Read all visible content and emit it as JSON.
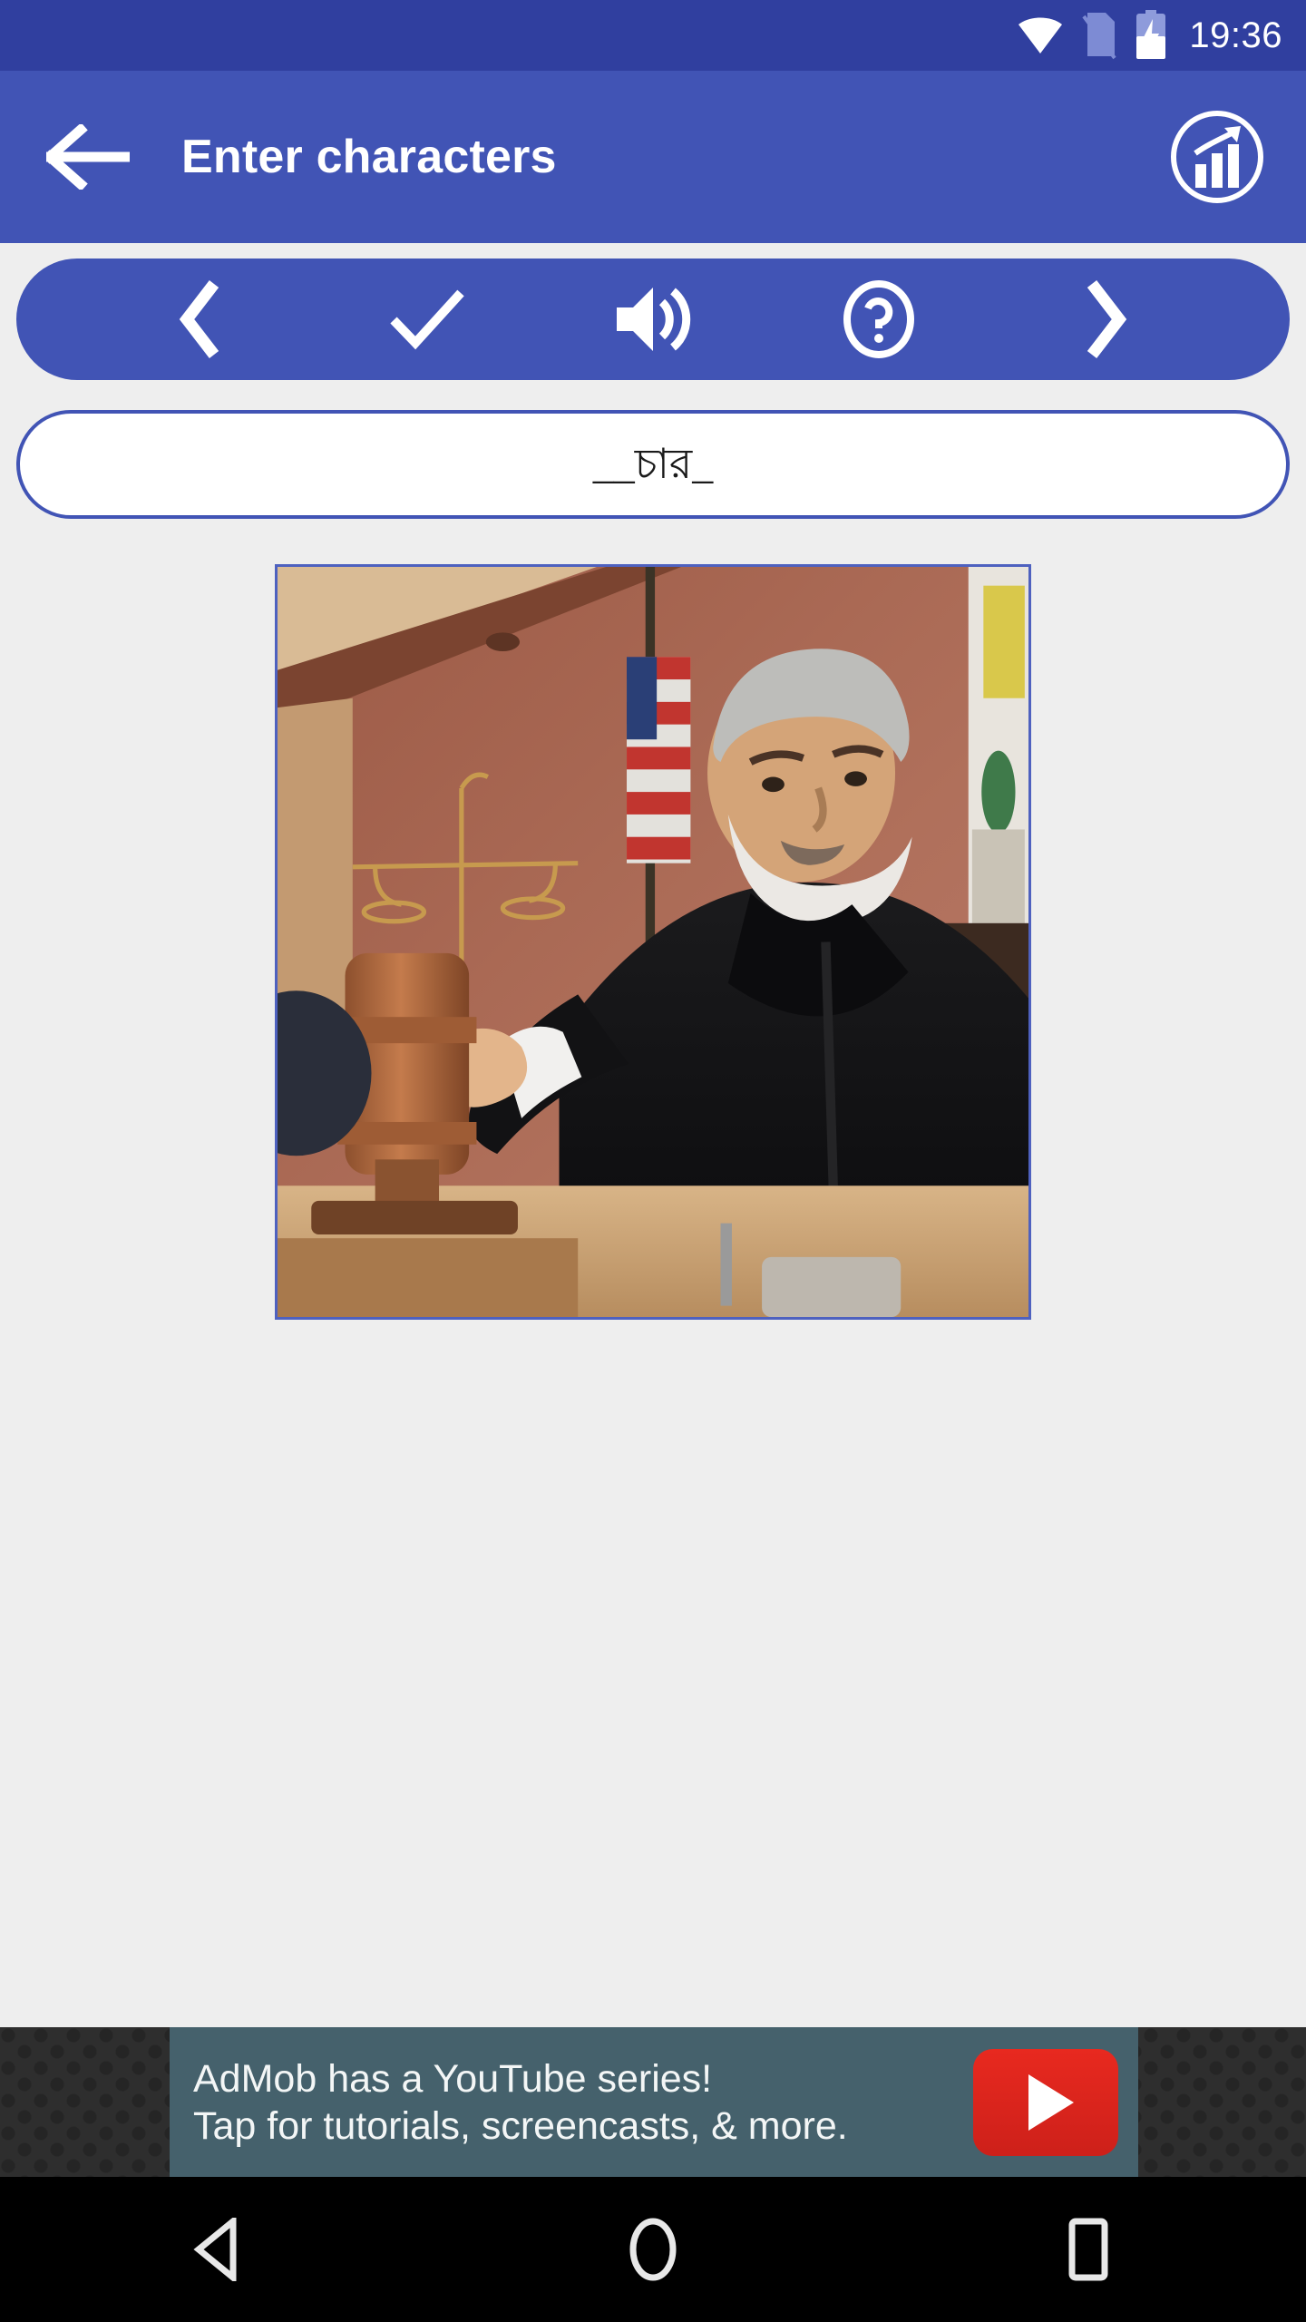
{
  "status_bar": {
    "time": "19:36",
    "wifi_icon": "wifi-icon",
    "sim_icon": "no-sim-icon",
    "battery_icon": "battery-charging-icon",
    "background_color": "#303f9f"
  },
  "app_bar": {
    "title": "Enter characters",
    "back_icon": "back-arrow-icon",
    "stats_icon": "bar-chart-progress-icon",
    "background_color": "#4154b5",
    "title_color": "#ffffff"
  },
  "action_toolbar": {
    "background_color": "#4154b5",
    "buttons": [
      {
        "name": "previous-button",
        "icon": "chevron-left-icon"
      },
      {
        "name": "check-button",
        "icon": "checkmark-icon"
      },
      {
        "name": "speak-button",
        "icon": "speaker-volume-icon"
      },
      {
        "name": "hint-button",
        "icon": "question-mark-circle-icon"
      },
      {
        "name": "next-button",
        "icon": "chevron-right-icon"
      }
    ]
  },
  "answer_field": {
    "value": "__চার_",
    "placeholder": "",
    "border_color": "#4154b5",
    "background_color": "#ffffff"
  },
  "word_image": {
    "alt": "Judge in black robe striking a gavel in a courtroom with an American flag",
    "border_color": "#4e61bf"
  },
  "ad": {
    "line1": "AdMob has a YouTube series!",
    "line2": "Tap for tutorials, screencasts, & more.",
    "button_icon": "youtube-play-icon",
    "panel_color": "#45616c",
    "button_color": "#e8291f"
  },
  "nav_bar": {
    "background_color": "#000000",
    "buttons": [
      {
        "name": "nav-back-button",
        "icon": "triangle-back-icon"
      },
      {
        "name": "nav-home-button",
        "icon": "circle-home-icon"
      },
      {
        "name": "nav-recents-button",
        "icon": "square-recents-icon"
      }
    ]
  },
  "page": {
    "background_color": "#eeeeee"
  }
}
